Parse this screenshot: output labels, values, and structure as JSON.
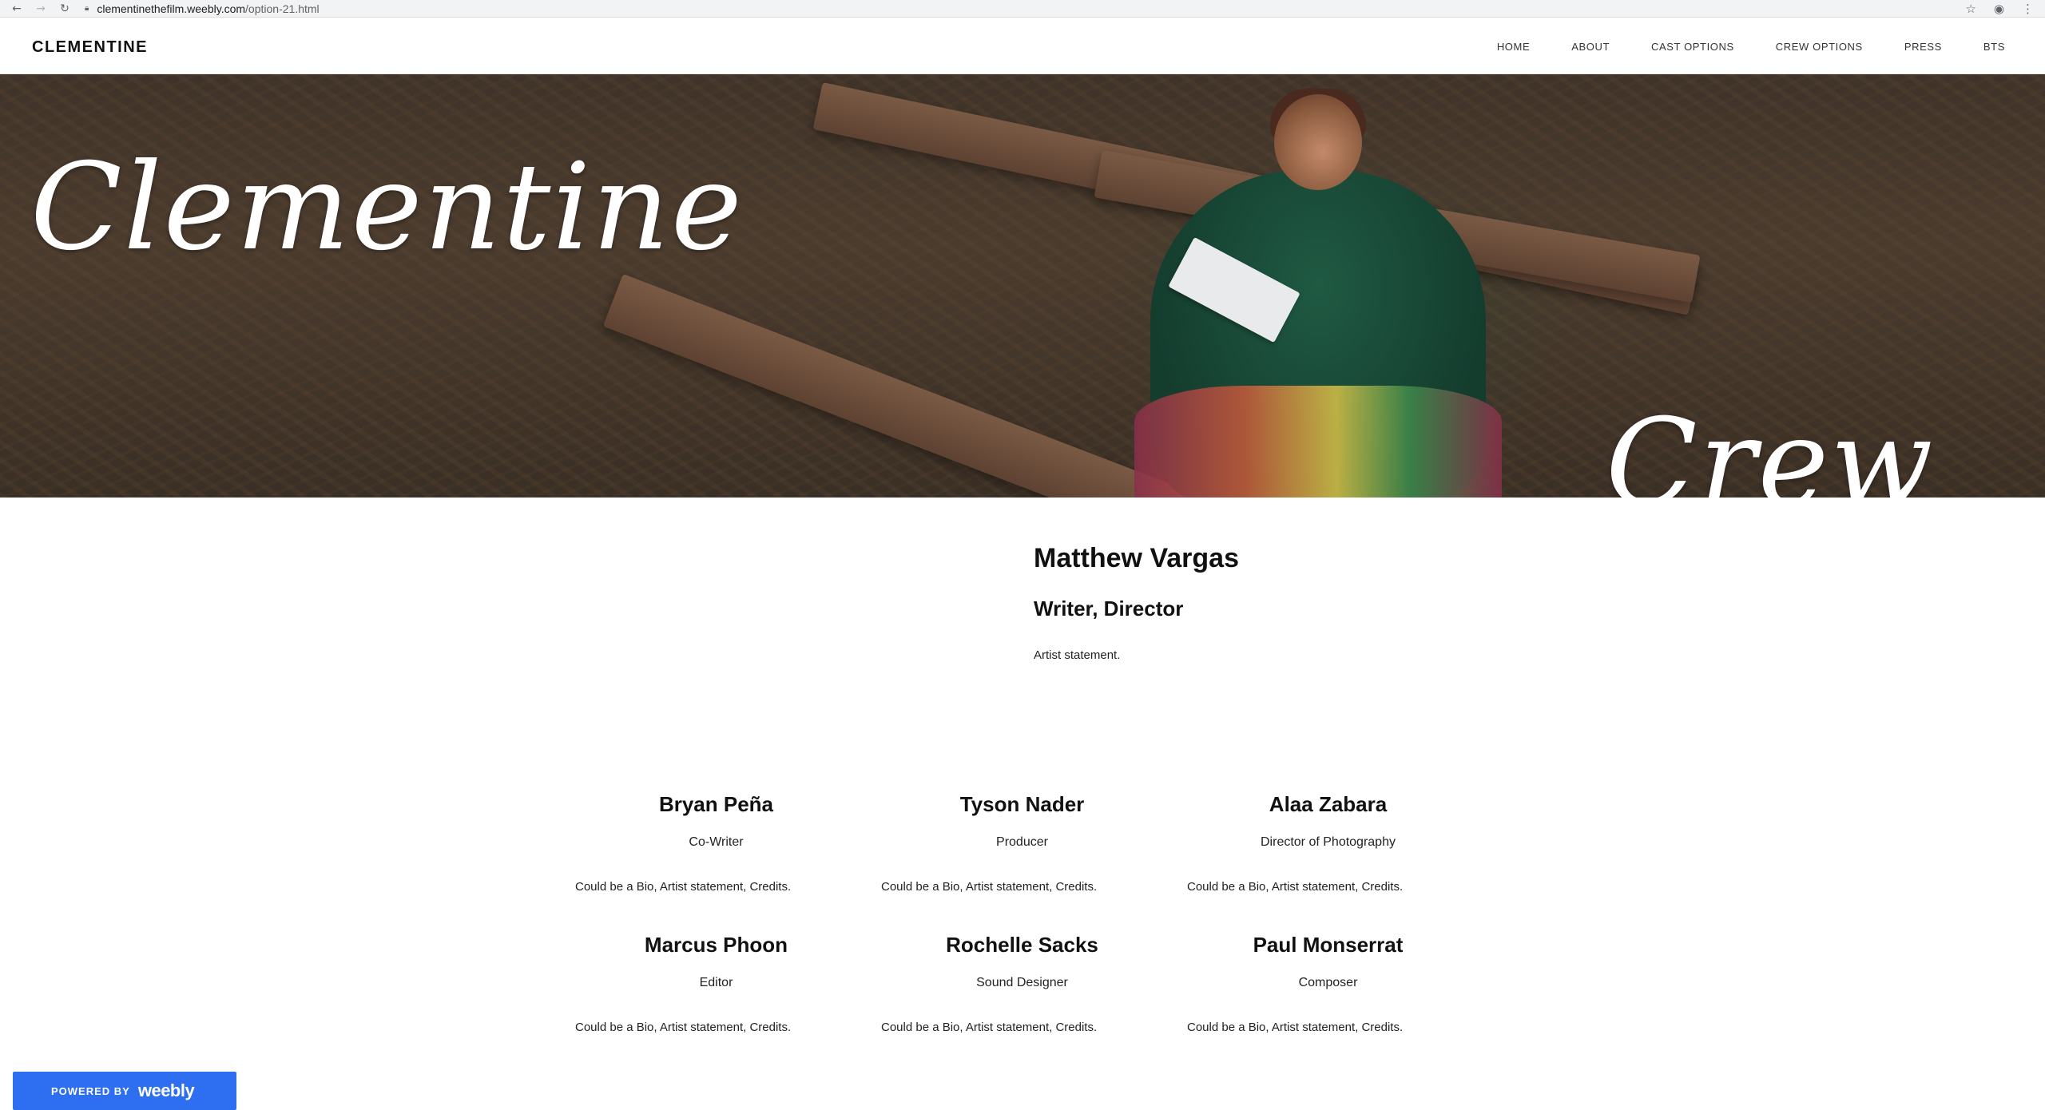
{
  "browser": {
    "url_host": "clementinethefilm.weebly.com",
    "url_path": "/option-21.html"
  },
  "site": {
    "title": "CLEMENTINE",
    "nav": [
      "HOME",
      "ABOUT",
      "CAST OPTIONS",
      "CREW OPTIONS",
      "PRESS",
      "BTS"
    ]
  },
  "hero": {
    "title": "Clementine",
    "subtitle": "Crew"
  },
  "featured": {
    "name": "Matthew Vargas",
    "role": "Writer, Director",
    "statement": "Artist statement."
  },
  "crew": [
    {
      "name": "Bryan Peña",
      "role": "Co-Writer",
      "bio": "Could be a Bio, Artist statement, Credits."
    },
    {
      "name": "Tyson Nader",
      "role": "Producer",
      "bio": "Could be a Bio, Artist statement, Credits."
    },
    {
      "name": "Alaa Zabara",
      "role": "Director of Photography",
      "bio": "Could be a Bio, Artist statement, Credits."
    },
    {
      "name": "Marcus Phoon",
      "role": "Editor",
      "bio": "Could be a Bio, Artist statement, Credits."
    },
    {
      "name": "Rochelle Sacks",
      "role": "Sound Designer",
      "bio": "Could be a Bio, Artist statement, Credits."
    },
    {
      "name": "Paul Monserrat",
      "role": "Composer",
      "bio": "Could be a Bio, Artist statement, Credits."
    }
  ],
  "badge": {
    "powered_by": "POWERED BY",
    "brand": "weebly"
  },
  "colors": {
    "badge_blue": "#2d6ff0",
    "text": "#111111"
  },
  "icons": [
    "back-arrow-icon",
    "forward-arrow-icon",
    "reload-icon",
    "lock-icon",
    "star-icon",
    "account-icon",
    "menu-dots-icon"
  ]
}
